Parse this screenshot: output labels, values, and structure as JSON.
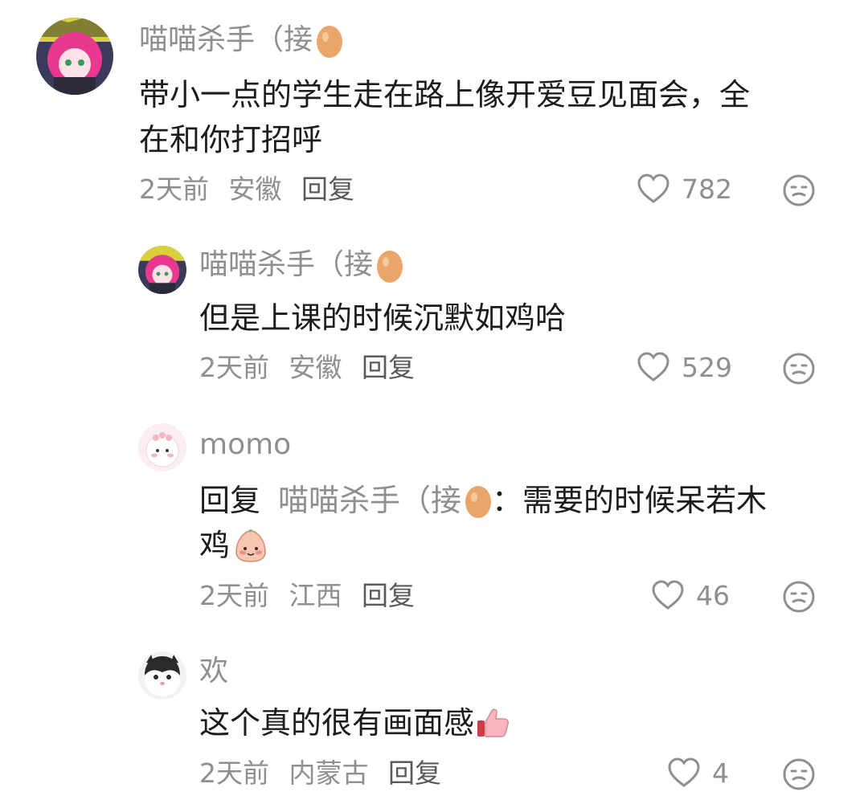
{
  "comments": [
    {
      "name": "喵喵杀手（接",
      "text_line1": "带小一点的学生走在路上像开爱豆见面会，全",
      "text_line2": "在和你打招呼",
      "time": "2天前",
      "location": "安徽",
      "reply_label": "回复",
      "likes": "782"
    },
    {
      "name": "喵喵杀手（接",
      "text_line1": "但是上课的时候沉默如鸡哈",
      "time": "2天前",
      "location": "安徽",
      "reply_label": "回复",
      "likes": "529"
    },
    {
      "name": "momo",
      "reply_prefix": "回复",
      "reply_target": "喵喵杀手（接",
      "text_after": "：需要的时候呆若木",
      "text_line2": "鸡",
      "time": "2天前",
      "location": "江西",
      "reply_label": "回复",
      "likes": "46"
    },
    {
      "name": "欢",
      "text_line1": "这个真的很有画面感",
      "time": "2天前",
      "location": "内蒙古",
      "reply_label": "回复",
      "likes": "4"
    }
  ],
  "icons": {
    "like": "heart-outline-icon",
    "dislike": "meh-face-icon",
    "egg": "egg-emoji",
    "blush": "blushing-bun-emoji",
    "thumbs": "thumbs-up-emoji"
  },
  "colors": {
    "text": "#1c1c1c",
    "muted": "#8f8f8f",
    "reply": "#5a5a5a",
    "egg": "#e9a56a"
  }
}
